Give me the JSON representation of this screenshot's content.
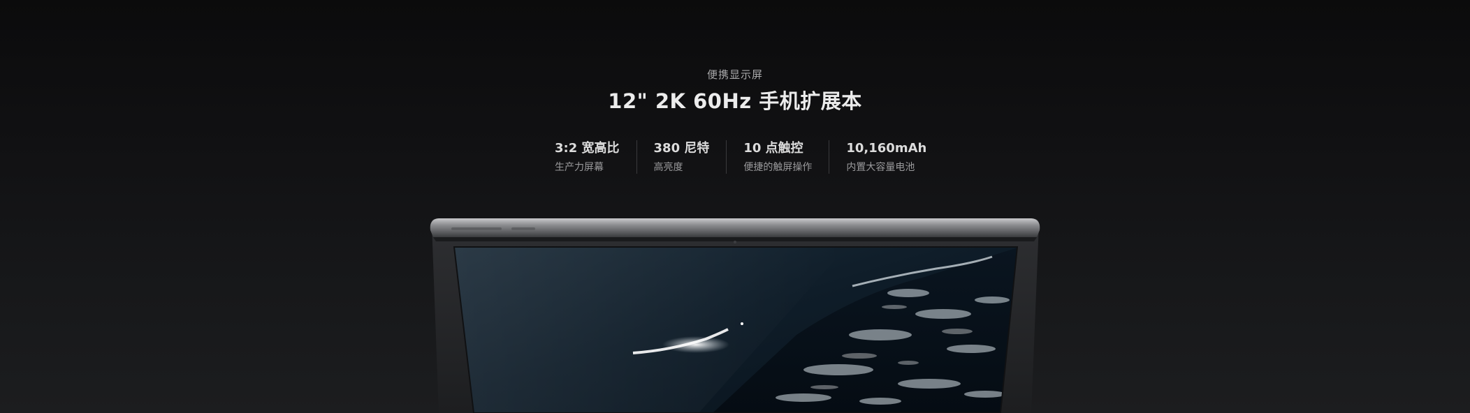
{
  "hero": {
    "eyebrow": "便携显示屏",
    "headline": "12\" 2K 60Hz 手机扩展本"
  },
  "specs": [
    {
      "title": "3:2 宽高比",
      "subtitle": "生产力屏幕"
    },
    {
      "title": "380 尼特",
      "subtitle": "高亮度"
    },
    {
      "title": "10 点触控",
      "subtitle": "便捷的触屏操作"
    },
    {
      "title": "10,160mAh",
      "subtitle": "内置大容量电池"
    }
  ],
  "colors": {
    "background_top": "#0b0b0c",
    "background_bottom": "#1c1d1f",
    "text_primary": "#ececec",
    "text_secondary": "#9a9a9c",
    "divider": "#3a3a3d",
    "device_frame": "#2b2c2e",
    "screen_ocean": "#0e1a24"
  },
  "device": {
    "image_name": "portable-display-product-image"
  }
}
